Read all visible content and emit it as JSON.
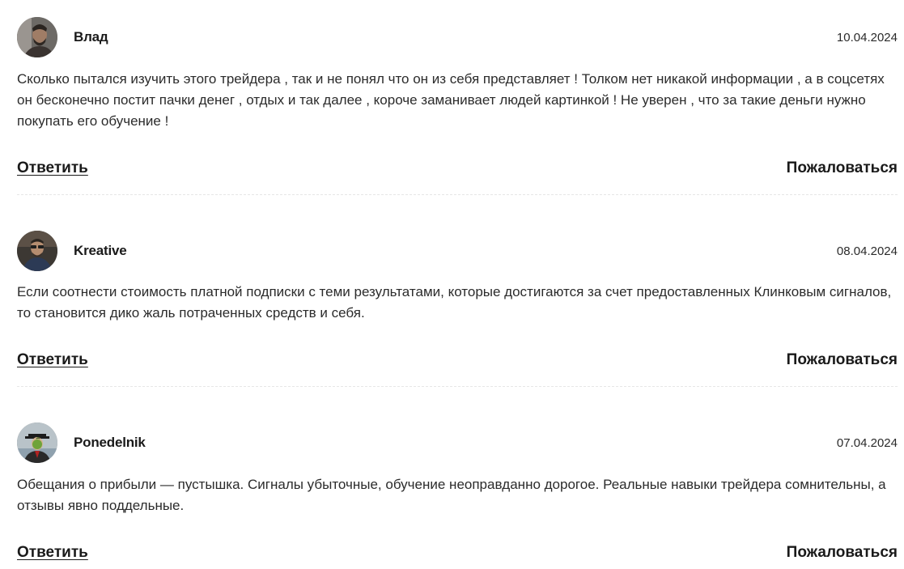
{
  "comments": [
    {
      "author": "Влад",
      "date": "10.04.2024",
      "avatar_icon": "user-photo-bearded-man",
      "text": "Сколько пытался изучить этого трейдера , так и не понял что он из себя представляет ! Толком нет никакой информации , а в соцсетях он бесконечно постит пачки денег , отдых и так далее , короче заманивает людей картинкой ! Не уверен , что за такие деньги нужно покупать его обучение !",
      "reply_label": "Ответить",
      "report_label": "Пожаловаться"
    },
    {
      "author": "Kreative",
      "date": "08.04.2024",
      "avatar_icon": "user-photo-man-glasses",
      "text": "Если соотнести стоимость платной подписки с теми результатами, которые достигаются за счет предоставленных Клинковым сигналов, то становится дико жаль потраченных средств и себя.",
      "reply_label": "Ответить",
      "report_label": "Пожаловаться"
    },
    {
      "author": "Ponedelnik",
      "date": "07.04.2024",
      "avatar_icon": "user-photo-man-bowler-hat-apple",
      "text": "Обещания о прибыли — пустышка. Сигналы убыточные, обучение неоправданно дорогое. Реальные навыки трейдера сомнительны, а отзывы явно поддельные.",
      "reply_label": "Ответить",
      "report_label": "Пожаловаться"
    }
  ],
  "colors": {
    "text": "#2b2b2b",
    "heading": "#1a1a1a",
    "divider": "#e6e6e6"
  }
}
